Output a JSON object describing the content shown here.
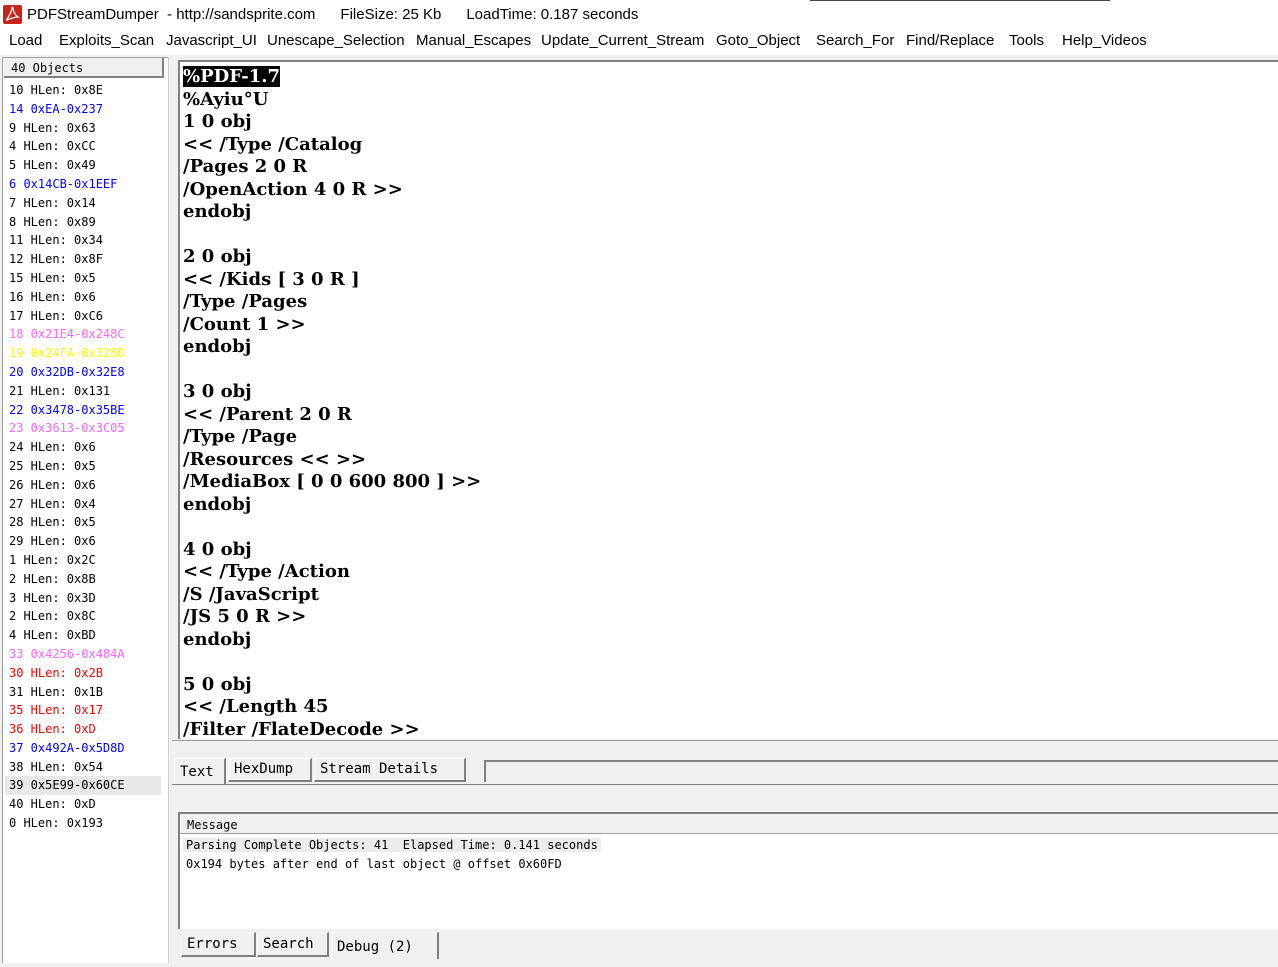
{
  "window": {
    "title": "PDFStreamDumper  - http://sandsprite.com      FileSize: 25 Kb      LoadTime: 0.187 seconds"
  },
  "menu": [
    "Load",
    "Exploits_Scan",
    "Javascript_UI",
    "Unescape_Selection",
    "Manual_Escapes",
    "Update_Current_Stream",
    "Goto_Object",
    "Search_For",
    "Find/Replace",
    "Tools",
    "Help_Videos"
  ],
  "object_list": {
    "header": "40 Objects",
    "rows": [
      {
        "text": "10 HLen: 0x8E",
        "color": "#000000"
      },
      {
        "text": "14 0xEA-0x237",
        "color": "#0000ff"
      },
      {
        "text": "9 HLen: 0x63",
        "color": "#000000"
      },
      {
        "text": "4 HLen: 0xCC",
        "color": "#000000"
      },
      {
        "text": "5 HLen: 0x49",
        "color": "#000000"
      },
      {
        "text": "6 0x14CB-0x1EEF",
        "color": "#0000ff"
      },
      {
        "text": "7 HLen: 0x14",
        "color": "#000000"
      },
      {
        "text": "8 HLen: 0x89",
        "color": "#000000"
      },
      {
        "text": "11 HLen: 0x34",
        "color": "#000000"
      },
      {
        "text": "12 HLen: 0x8F",
        "color": "#000000"
      },
      {
        "text": "15 HLen: 0x5",
        "color": "#000000"
      },
      {
        "text": "16 HLen: 0x6",
        "color": "#000000"
      },
      {
        "text": "17 HLen: 0xC6",
        "color": "#000000"
      },
      {
        "text": "18 0x21E4-0x248C",
        "color": "#ff66ff"
      },
      {
        "text": "19 0x24FA-0x328D",
        "color": "#ffff00"
      },
      {
        "text": "20 0x32DB-0x32E8",
        "color": "#0000ff"
      },
      {
        "text": "21 HLen: 0x131",
        "color": "#000000"
      },
      {
        "text": "22 0x3478-0x35BE",
        "color": "#0000ff"
      },
      {
        "text": "23 0x3613-0x3C05",
        "color": "#ff66ff"
      },
      {
        "text": "24 HLen: 0x6",
        "color": "#000000"
      },
      {
        "text": "25 HLen: 0x5",
        "color": "#000000"
      },
      {
        "text": "26 HLen: 0x6",
        "color": "#000000"
      },
      {
        "text": "27 HLen: 0x4",
        "color": "#000000"
      },
      {
        "text": "28 HLen: 0x5",
        "color": "#000000"
      },
      {
        "text": "29 HLen: 0x6",
        "color": "#000000"
      },
      {
        "text": "1 HLen: 0x2C",
        "color": "#000000"
      },
      {
        "text": "2 HLen: 0x8B",
        "color": "#000000"
      },
      {
        "text": "3 HLen: 0x3D",
        "color": "#000000"
      },
      {
        "text": "2 HLen: 0x8C",
        "color": "#000000"
      },
      {
        "text": "4 HLen: 0xBD",
        "color": "#000000"
      },
      {
        "text": "33 0x4256-0x484A",
        "color": "#ff66ff"
      },
      {
        "text": "30 HLen: 0x2B",
        "color": "#ff0000"
      },
      {
        "text": "31 HLen: 0x1B",
        "color": "#000000"
      },
      {
        "text": "35 HLen: 0x17",
        "color": "#ff0000"
      },
      {
        "text": "36 HLen: 0xD",
        "color": "#ff0000"
      },
      {
        "text": "37 0x492A-0x5D8D",
        "color": "#0000ff"
      },
      {
        "text": "38 HLen: 0x54",
        "color": "#000000"
      },
      {
        "text": "39 0x5E99-0x60CE",
        "color": "#000000"
      },
      {
        "text": "40 HLen: 0xD",
        "color": "#000000"
      },
      {
        "text": "0 HLen: 0x193",
        "color": "#000000"
      }
    ],
    "selected_index": 37
  },
  "editor": {
    "highlighted_text": "%PDF-1.7",
    "lines": [
      "%Ayiu°U",
      "1 0 obj",
      "<< /Type /Catalog",
      "/Pages 2 0 R",
      "/OpenAction 4 0 R >>",
      "endobj",
      "",
      "2 0 obj",
      "<< /Kids [ 3 0 R ]",
      "/Type /Pages",
      "/Count 1 >>",
      "endobj",
      "",
      "3 0 obj",
      "<< /Parent 2 0 R",
      "/Type /Page",
      "/Resources << >>",
      "/MediaBox [ 0 0 600 800 ] >>",
      "endobj",
      "",
      "4 0 obj",
      "<< /Type /Action",
      "/S /JavaScript",
      "/JS 5 0 R >>",
      "endobj",
      "",
      "5 0 obj",
      "<< /Length 45",
      "/Filter /FlateDecode >>"
    ]
  },
  "editor_tabs": [
    "Text",
    "HexDump",
    "Stream Details"
  ],
  "message": {
    "header": "Message",
    "lines": [
      "Parsing Complete Objects: 41  Elapsed Time: 0.141 seconds",
      "0x194 bytes after end of last object @ offset 0x60FD"
    ]
  },
  "bottom_tabs": [
    "Errors",
    "Search",
    "Debug (2)"
  ]
}
